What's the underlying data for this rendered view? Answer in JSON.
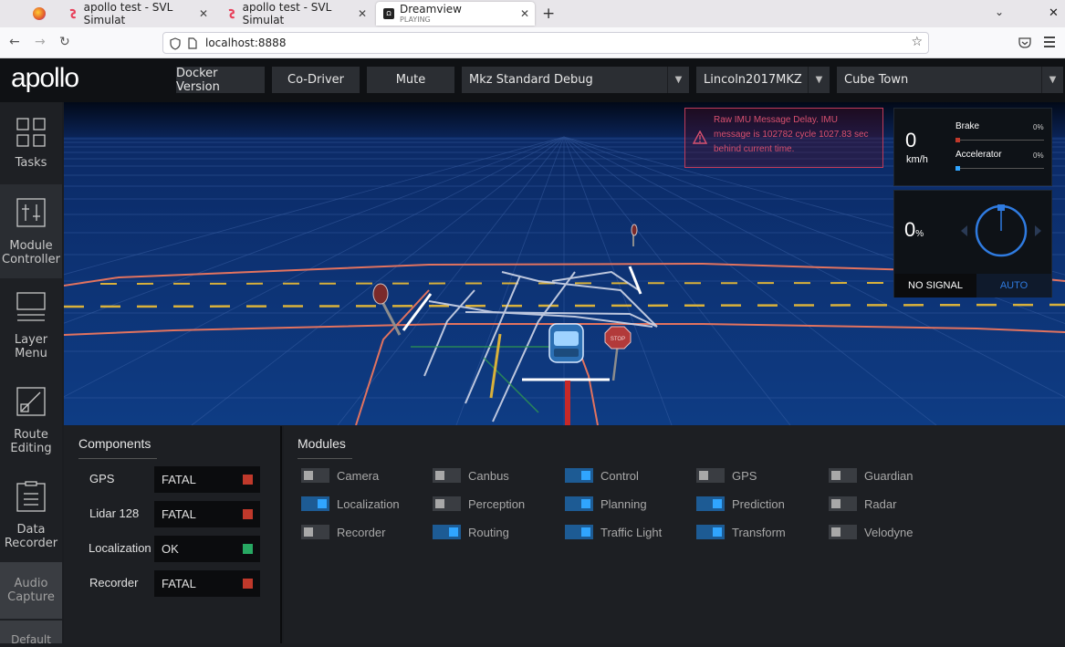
{
  "browser": {
    "tabs": [
      {
        "title": "apollo test - SVL Simulat"
      },
      {
        "title": "apollo test - SVL Simulat"
      },
      {
        "title": "Dreamview",
        "subtitle": "PLAYING"
      }
    ],
    "url": "localhost:8888"
  },
  "header": {
    "logo": "apollo",
    "docker_label": "Docker Version",
    "codriver_label": "Co-Driver",
    "mute_label": "Mute",
    "mode_value": "Mkz Standard Debug",
    "vehicle_value": "Lincoln2017MKZ",
    "map_value": "Cube Town"
  },
  "sidebar": {
    "items": [
      {
        "label1": "Tasks",
        "label2": ""
      },
      {
        "label1": "Module",
        "label2": "Controller"
      },
      {
        "label1": "Layer",
        "label2": "Menu"
      },
      {
        "label1": "Route",
        "label2": "Editing"
      },
      {
        "label1": "Data",
        "label2": "Recorder"
      },
      {
        "label1": "Audio",
        "label2": "Capture"
      },
      {
        "label1": "Default",
        "label2": ""
      }
    ]
  },
  "alert": {
    "message": "Raw IMU Message Delay. IMU message is 102782 cycle 1027.83 sec behind current time."
  },
  "dash": {
    "speed": "0",
    "speed_unit": "km/h",
    "brake_label": "Brake",
    "brake_value": "0%",
    "accel_label": "Accelerator",
    "accel_value": "0%",
    "steer_value": "0",
    "steer_unit": "%",
    "signal_label": "NO SIGNAL",
    "mode_label": "AUTO"
  },
  "components": {
    "title": "Components",
    "rows": [
      {
        "label": "GPS",
        "status": "FATAL",
        "color": "#c0392b"
      },
      {
        "label": "Lidar 128",
        "status": "FATAL",
        "color": "#c0392b"
      },
      {
        "label": "Localization",
        "status": "OK",
        "color": "#27a862"
      },
      {
        "label": "Recorder",
        "status": "FATAL",
        "color": "#c0392b"
      }
    ]
  },
  "modules": {
    "title": "Modules",
    "items": [
      {
        "label": "Camera",
        "on": false
      },
      {
        "label": "Canbus",
        "on": false
      },
      {
        "label": "Control",
        "on": true
      },
      {
        "label": "GPS",
        "on": false
      },
      {
        "label": "Guardian",
        "on": false
      },
      {
        "label": "Localization",
        "on": true
      },
      {
        "label": "Perception",
        "on": false
      },
      {
        "label": "Planning",
        "on": true
      },
      {
        "label": "Prediction",
        "on": true
      },
      {
        "label": "Radar",
        "on": false
      },
      {
        "label": "Recorder",
        "on": false
      },
      {
        "label": "Routing",
        "on": true
      },
      {
        "label": "Traffic Light",
        "on": true
      },
      {
        "label": "Transform",
        "on": true
      },
      {
        "label": "Velodyne",
        "on": false
      }
    ]
  },
  "colors": {
    "accent": "#30a5ff",
    "alert": "#d8506f",
    "fatal": "#c0392b",
    "ok": "#27a862"
  }
}
